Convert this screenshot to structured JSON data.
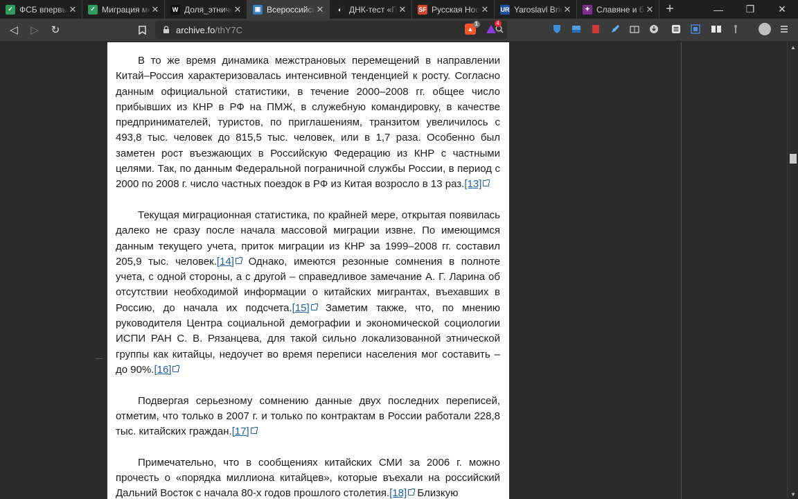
{
  "tabs": [
    {
      "title": "ФСБ впервые",
      "color": "#2e9b5a",
      "glyph": "✓"
    },
    {
      "title": "Миграция ме",
      "color": "#2e9b5a",
      "glyph": "✓"
    },
    {
      "title": "Доля_этничес",
      "color": "#111111",
      "glyph": "W"
    },
    {
      "title": "Всероссийская",
      "color": "#3a7fc2",
      "glyph": "▣"
    },
    {
      "title": "ДНК-тест «Ге",
      "color": "#222222",
      "glyph": "◐"
    },
    {
      "title": "Русская Ноос",
      "color": "#d2472b",
      "glyph": "SF"
    },
    {
      "title": "Yaroslavl Brigh",
      "color": "#1d4fa0",
      "glyph": "UR"
    },
    {
      "title": "Славяне и ба",
      "color": "#7a2e8c",
      "glyph": "✦"
    }
  ],
  "active_tab_index": 3,
  "new_tab_label": "+",
  "window_controls": {
    "minimize": "—",
    "maximize": "❐",
    "close": "✕"
  },
  "toolbar": {
    "back": "◁",
    "forward": "▷",
    "reload": "↻",
    "bookmark": "⚑"
  },
  "url": {
    "host": "archive.fo",
    "path": "/thY7C"
  },
  "brave_badge": "1",
  "rewards_badge": "4",
  "article": {
    "paragraphs": [
      {
        "text": "В то же время динамика межстрановых перемещений в направлении Китай–Россия характеризовалась интенсивной тенденцией к росту. Согласно данным официальной статистики, в течение 2000–2008 гг. общее число прибывших из КНР в РФ на ПМЖ, в служебную командировку, в качестве предпринимателей, туристов, по приглашениям, транзитом увеличилось с 493,8 тыс. человек до 815,5 тыс. человек, или в 1,7 раза. Особенно был заметен рост въезжающих в Российскую Федерацию из КНР с частными целями. Так, по данным Федеральной пограничной службы России, в период с 2000 по 2008 г. число частных поездок в РФ из Китая возросло в 13 раз.",
        "ref": "[13]"
      },
      {
        "text": "Текущая миграционная статистика, по крайней мере, открытая появилась далеко не сразу после начала массовой миграции извне. По имеющимся данным текущего учета, приток миграции из КНР за 1999–2008 гг. составил 205,9 тыс. человек.",
        "ref": "[14]",
        "text2": " Однако, имеются резонные сомнения в полноте учета, с одной стороны, а с другой – справедливое замечание А. Г. Ларина об отсутствии необходимой информации о китайских мигрантах, въехавших в Россию, до начала их подсчета.",
        "ref2": "[15]",
        "text3": " Заметим также, что, по мнению руководителя Центра социальной демографии и экономической социологии ИСПИ РАН С. В. Рязанцева, для такой сильно локализованной этнической группы как китайцы, недоучет во время переписи населения мог составить – до 90%.",
        "ref3": "[16]"
      },
      {
        "text": "Подвергая серьезному сомнению данные двух последних переписей, отметим, что только в 2007 г. и только по контрактам в России работали 228,8 тыс. китайских граждан.",
        "ref": "[17]"
      },
      {
        "text": "Примечательно, что в сообщениях китайских СМИ за 2006 г. можно прочесть о «порядка миллиона китайцев», которые въехали на российский Дальний Восток с начала 80-х годов прошлого столетия.",
        "ref": "[18]",
        "text2": " Близкую"
      }
    ]
  }
}
